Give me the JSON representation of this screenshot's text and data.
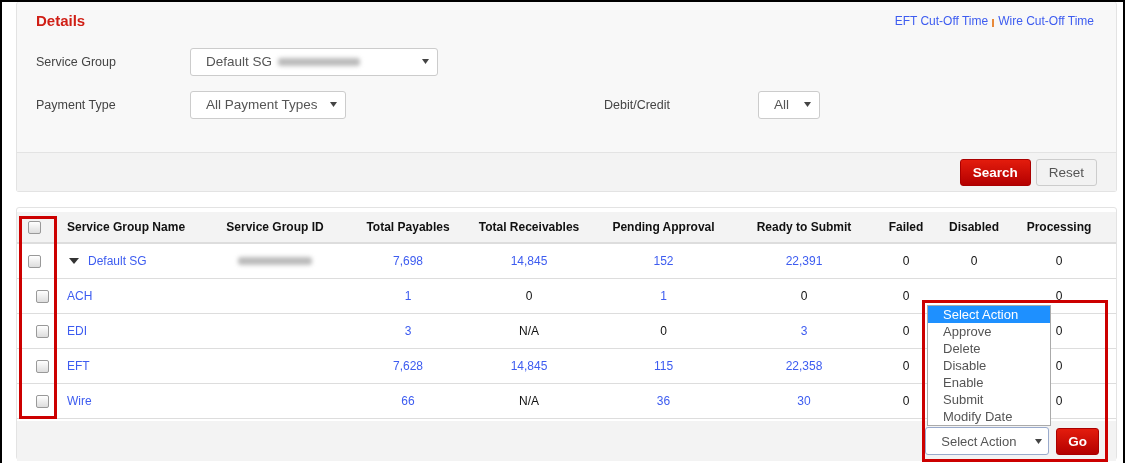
{
  "details": {
    "title": "Details",
    "links": [
      "EFT Cut-Off Time",
      "Wire Cut-Off Time"
    ],
    "filters": [
      {
        "label": "Service Group",
        "value": "Default SG",
        "redacted": true
      },
      {
        "label": "Payment Type",
        "value": "All Payment Types",
        "redacted": false
      },
      {
        "label": "Debit/Credit",
        "value": "All",
        "redacted": false
      }
    ],
    "buttons": [
      {
        "label": "Search",
        "kind": "primary"
      },
      {
        "label": "Reset",
        "kind": "secondary"
      }
    ]
  },
  "table": {
    "select_all": {
      "checked": false
    },
    "columns": [
      "Service Group Name",
      "Service Group ID",
      "Total Payables",
      "Total Receivables",
      "Pending Approval",
      "Ready to Submit",
      "Failed",
      "Disabled",
      "Processing"
    ],
    "rows": [
      {
        "expanded": true,
        "checked": false,
        "id_redacted": true,
        "cells": [
          {
            "text": "Default SG",
            "link": true
          },
          null,
          {
            "text": "7,698",
            "link": true
          },
          {
            "text": "14,845",
            "link": true
          },
          {
            "text": "152",
            "link": true
          },
          {
            "text": "22,391",
            "link": true
          },
          {
            "text": "0",
            "link": false
          },
          {
            "text": "0",
            "link": false
          },
          {
            "text": "0",
            "link": false
          }
        ]
      },
      {
        "checked": false,
        "id_redacted": false,
        "cells": [
          {
            "text": "ACH",
            "link": true
          },
          null,
          {
            "text": "1",
            "link": true
          },
          {
            "text": "0",
            "link": false
          },
          {
            "text": "1",
            "link": true
          },
          {
            "text": "0",
            "link": false
          },
          {
            "text": "0",
            "link": false
          },
          null,
          {
            "text": "0",
            "link": false
          }
        ]
      },
      {
        "checked": false,
        "id_redacted": false,
        "cells": [
          {
            "text": "EDI",
            "link": true
          },
          null,
          {
            "text": "3",
            "link": true
          },
          {
            "text": "N/A",
            "link": false
          },
          {
            "text": "0",
            "link": false
          },
          {
            "text": "3",
            "link": true
          },
          {
            "text": "0",
            "link": false
          },
          null,
          {
            "text": "0",
            "link": false
          }
        ]
      },
      {
        "checked": false,
        "id_redacted": false,
        "cells": [
          {
            "text": "EFT",
            "link": true
          },
          null,
          {
            "text": "7,628",
            "link": true
          },
          {
            "text": "14,845",
            "link": true
          },
          {
            "text": "115",
            "link": true
          },
          {
            "text": "22,358",
            "link": true
          },
          {
            "text": "0",
            "link": false
          },
          null,
          {
            "text": "0",
            "link": false
          }
        ]
      },
      {
        "checked": false,
        "id_redacted": false,
        "cells": [
          {
            "text": "Wire",
            "link": true
          },
          null,
          {
            "text": "66",
            "link": true
          },
          {
            "text": "N/A",
            "link": false
          },
          {
            "text": "36",
            "link": true
          },
          {
            "text": "30",
            "link": true
          },
          {
            "text": "0",
            "link": false
          },
          null,
          {
            "text": "0",
            "link": false
          }
        ]
      }
    ]
  },
  "action": {
    "value": "Select Action",
    "options": [
      {
        "label": "Select Action",
        "selected": true
      },
      {
        "label": "Approve",
        "selected": false
      },
      {
        "label": "Delete",
        "selected": false
      },
      {
        "label": "Disable",
        "selected": false
      },
      {
        "label": "Enable",
        "selected": false
      },
      {
        "label": "Submit",
        "selected": false
      },
      {
        "label": "Modify Date",
        "selected": false
      }
    ],
    "go": "Go",
    "open": true
  }
}
